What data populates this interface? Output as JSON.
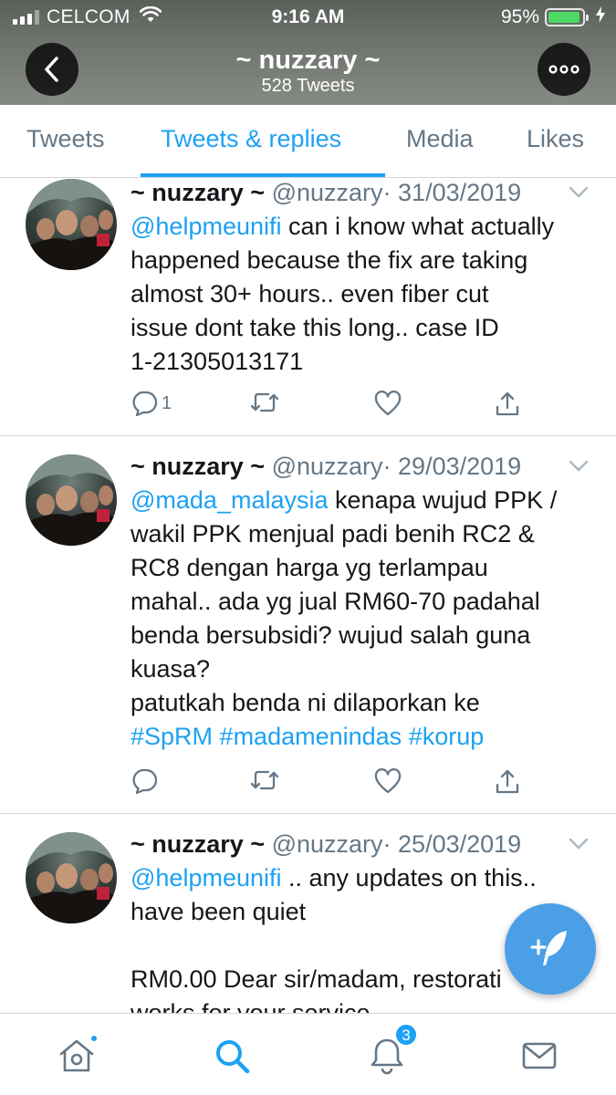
{
  "status_bar": {
    "carrier": "CELCOM",
    "time": "9:16 AM",
    "battery": "95%",
    "battery_level": 0.95,
    "icons": [
      "signal-icon",
      "wifi-icon",
      "battery-icon",
      "charging-icon"
    ]
  },
  "header": {
    "name": "~ nuzzary ~",
    "tweet_count": "528 Tweets",
    "back_icon": "back-arrow-icon",
    "more_icon": "more-icon"
  },
  "tabs": [
    {
      "label": "Tweets",
      "active": false
    },
    {
      "label": "Tweets & replies",
      "active": true
    },
    {
      "label": "Media",
      "active": false
    },
    {
      "label": "Likes",
      "active": false
    }
  ],
  "tweets": [
    {
      "name": "~ nuzzary ~",
      "handle": "@nuzzary",
      "date": "· 31/03/2019",
      "mention": "@helpmeunifi",
      "lines": [
        "can i know what actually",
        "happened because the fix are taking",
        "almost 30+ hours.. even fiber cut",
        "issue dont take this long.. case ID",
        "1-21305013171"
      ],
      "reply_count": "1"
    },
    {
      "name": "~ nuzzary ~",
      "handle": "@nuzzary",
      "date": "· 29/03/2019",
      "mention": "@mada_malaysia",
      "lines": [
        "kenapa wujud PPK /",
        "wakil PPK menjual padi benih RC2 &",
        "RC8 dengan harga yg terlampau",
        "mahal.. ada yg jual RM60-70 padahal",
        "benda bersubsidi? wujud salah guna",
        "kuasa?",
        "patutkah benda ni dilaporkan ke"
      ],
      "hashtags": [
        "#SpRM",
        "#madamenindas",
        "#korup"
      ],
      "reply_count": ""
    },
    {
      "name": "~ nuzzary ~",
      "handle": "@nuzzary",
      "date": "· 25/03/2019",
      "mention": "@helpmeunifi",
      "lines": [
        ".. any updates on this..",
        "have been quiet",
        "",
        "RM0.00 Dear sir/madam, restorati",
        "works for your service"
      ]
    }
  ],
  "bottom_nav": {
    "items": [
      "home-icon",
      "search-icon",
      "notifications-icon",
      "messages-icon"
    ],
    "notification_badge": "3"
  },
  "colors": {
    "accent": "#1da1f2",
    "text": "#14171a",
    "muted": "#657786",
    "fab": "#4a9fe6"
  }
}
